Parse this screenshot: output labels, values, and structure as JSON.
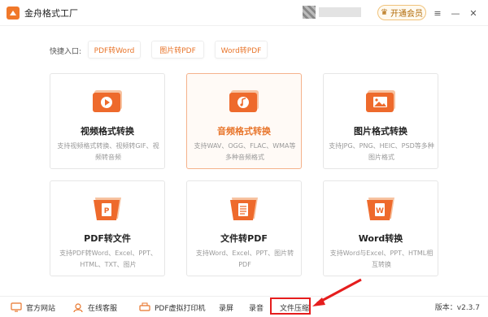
{
  "app": {
    "title": "金舟格式工厂",
    "vip_label": "开通会员"
  },
  "quick_entry": {
    "label": "快捷入口:",
    "buttons": [
      "PDF转Word",
      "图片转PDF",
      "Word转PDF"
    ]
  },
  "cards": [
    {
      "title": "视频格式转换",
      "desc": "支持视频格式转换、视频转GIF、视频转音频",
      "icon": "video-icon"
    },
    {
      "title": "音频格式转换",
      "desc": "支持WAV、OGG、FLAC、WMA等多种音频格式",
      "icon": "audio-icon",
      "active": true
    },
    {
      "title": "图片格式转换",
      "desc": "支持JPG、PNG、HEIC、PSD等多种图片格式",
      "icon": "image-icon"
    },
    {
      "title": "PDF转文件",
      "desc": "支持PDF转Word、Excel、PPT、HTML、TXT、图片",
      "icon": "pdf-icon"
    },
    {
      "title": "文件转PDF",
      "desc": "支持Word、Excel、PPT、图片转PDF",
      "icon": "document-icon"
    },
    {
      "title": "Word转换",
      "desc": "支持Word与Excel、PPT、HTML相互转换",
      "icon": "word-icon"
    }
  ],
  "bottombar": {
    "items": [
      "官方网站",
      "在线客服",
      "PDF虚拟打印机",
      "录屏",
      "录音",
      "文件压缩"
    ],
    "version": "版本：v2.3.7"
  },
  "colors": {
    "accent": "#e8752b",
    "highlight": "#e51d1d"
  }
}
